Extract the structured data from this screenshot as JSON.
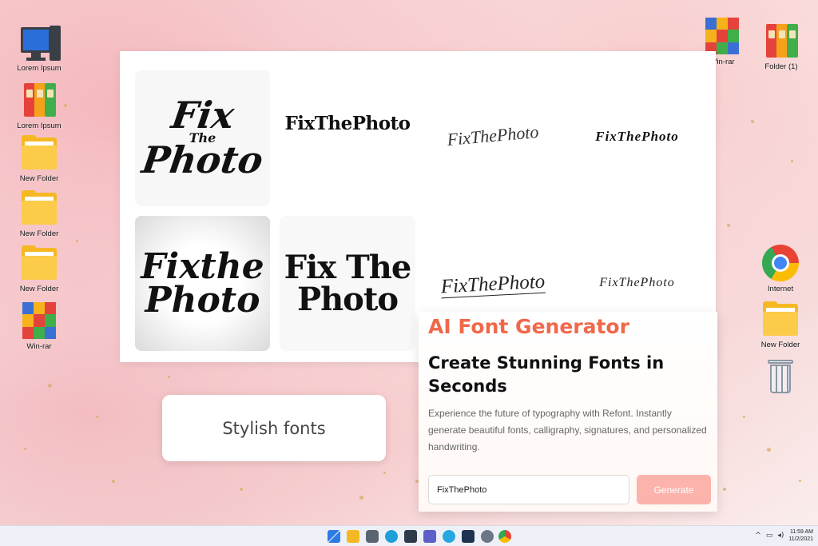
{
  "desktop": {
    "left_icons": [
      {
        "label": "Lorem Ipsum",
        "icon": "computer-icon"
      },
      {
        "label": "Lorem Ipsum",
        "icon": "binders-icon"
      },
      {
        "label": "New Folder",
        "icon": "folder-icon"
      },
      {
        "label": "New Folder",
        "icon": "folder-icon"
      },
      {
        "label": "New Folder",
        "icon": "folder-icon"
      },
      {
        "label": "Win-rar",
        "icon": "winrar-icon"
      }
    ],
    "right_icons": [
      {
        "label": "Win-rar",
        "icon": "winrar-icon"
      },
      {
        "label": "Folder (1)",
        "icon": "binders-icon"
      },
      {
        "label": "Internet",
        "icon": "chrome-icon"
      },
      {
        "label": "New Folder",
        "icon": "folder-icon"
      },
      {
        "label": "",
        "icon": "recycle-bin-icon"
      }
    ]
  },
  "font_samples": {
    "s1": {
      "line1": "Fix",
      "line2": "The",
      "line3": "Photo"
    },
    "s2": "FixThePhoto",
    "s3": "FixThePhoto",
    "s4": "FixThePhoto",
    "s5": {
      "line1": "Fixthe",
      "line2": "Photo"
    },
    "s6": {
      "line1": "Fix The",
      "line2": "Photo"
    },
    "s7": "FixThePhoto",
    "s8": "FixThePhoto"
  },
  "stylish_card": {
    "label": "Stylish fonts"
  },
  "generator": {
    "title": "AI Font Generator",
    "heading": "Create Stunning Fonts in Seconds",
    "description": "Experience the future of typography with Refont. Instantly generate beautiful fonts, calligraphy, signatures, and personalized handwriting.",
    "input_value": "FixThePhoto",
    "button_label": "Generate",
    "accent_color": "#f0684a",
    "button_color": "#fbb3ab"
  },
  "taskbar": {
    "time": "11:59 AM",
    "date": "11/2/2021",
    "tray_chevron": "^"
  }
}
